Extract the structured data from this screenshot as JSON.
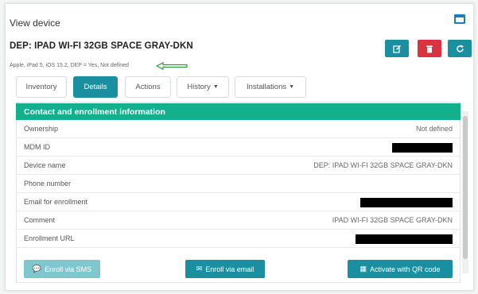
{
  "window": {
    "title": "View device",
    "maximize_icon": "window-maximize-icon"
  },
  "device": {
    "name": "DEP: IPAD WI-FI 32GB SPACE GRAY-DKN",
    "subtitle": "Apple, iPad 5, iOS 15.2, DEP = Yes, Not defined"
  },
  "actions": {
    "edit_icon": "edit-icon",
    "delete_icon": "trash-icon",
    "refresh_icon": "refresh-icon"
  },
  "tabs": [
    {
      "label": "Inventory",
      "active": false
    },
    {
      "label": "Details",
      "active": true
    },
    {
      "label": "Actions",
      "active": false
    },
    {
      "label": "History",
      "active": false,
      "dropdown": true
    },
    {
      "label": "Installations",
      "active": false,
      "dropdown": true
    }
  ],
  "section": {
    "title": "Contact and enrollment information",
    "rows": [
      {
        "label": "Ownership",
        "value": "Not defined"
      },
      {
        "label": "MDM ID",
        "value": "",
        "redacted": true
      },
      {
        "label": "Device name",
        "value": "DEP: IPAD WI-FI 32GB SPACE GRAY-DKN"
      },
      {
        "label": "Phone number",
        "value": ""
      },
      {
        "label": "Email for enrollment",
        "value": "",
        "redacted": true
      },
      {
        "label": "Comment",
        "value": "IPAD WI-FI 32GB SPACE GRAY-DKN"
      },
      {
        "label": "Enrollment URL",
        "value": "",
        "redacted": true
      }
    ]
  },
  "buttons": {
    "sms": "Enroll via SMS",
    "email": "Enroll via email",
    "qr": "Activate with QR code"
  },
  "colors": {
    "accent": "#1a8fa0",
    "header": "#13b08e",
    "danger": "#d9333f",
    "arrow": "#2e9a3a"
  }
}
